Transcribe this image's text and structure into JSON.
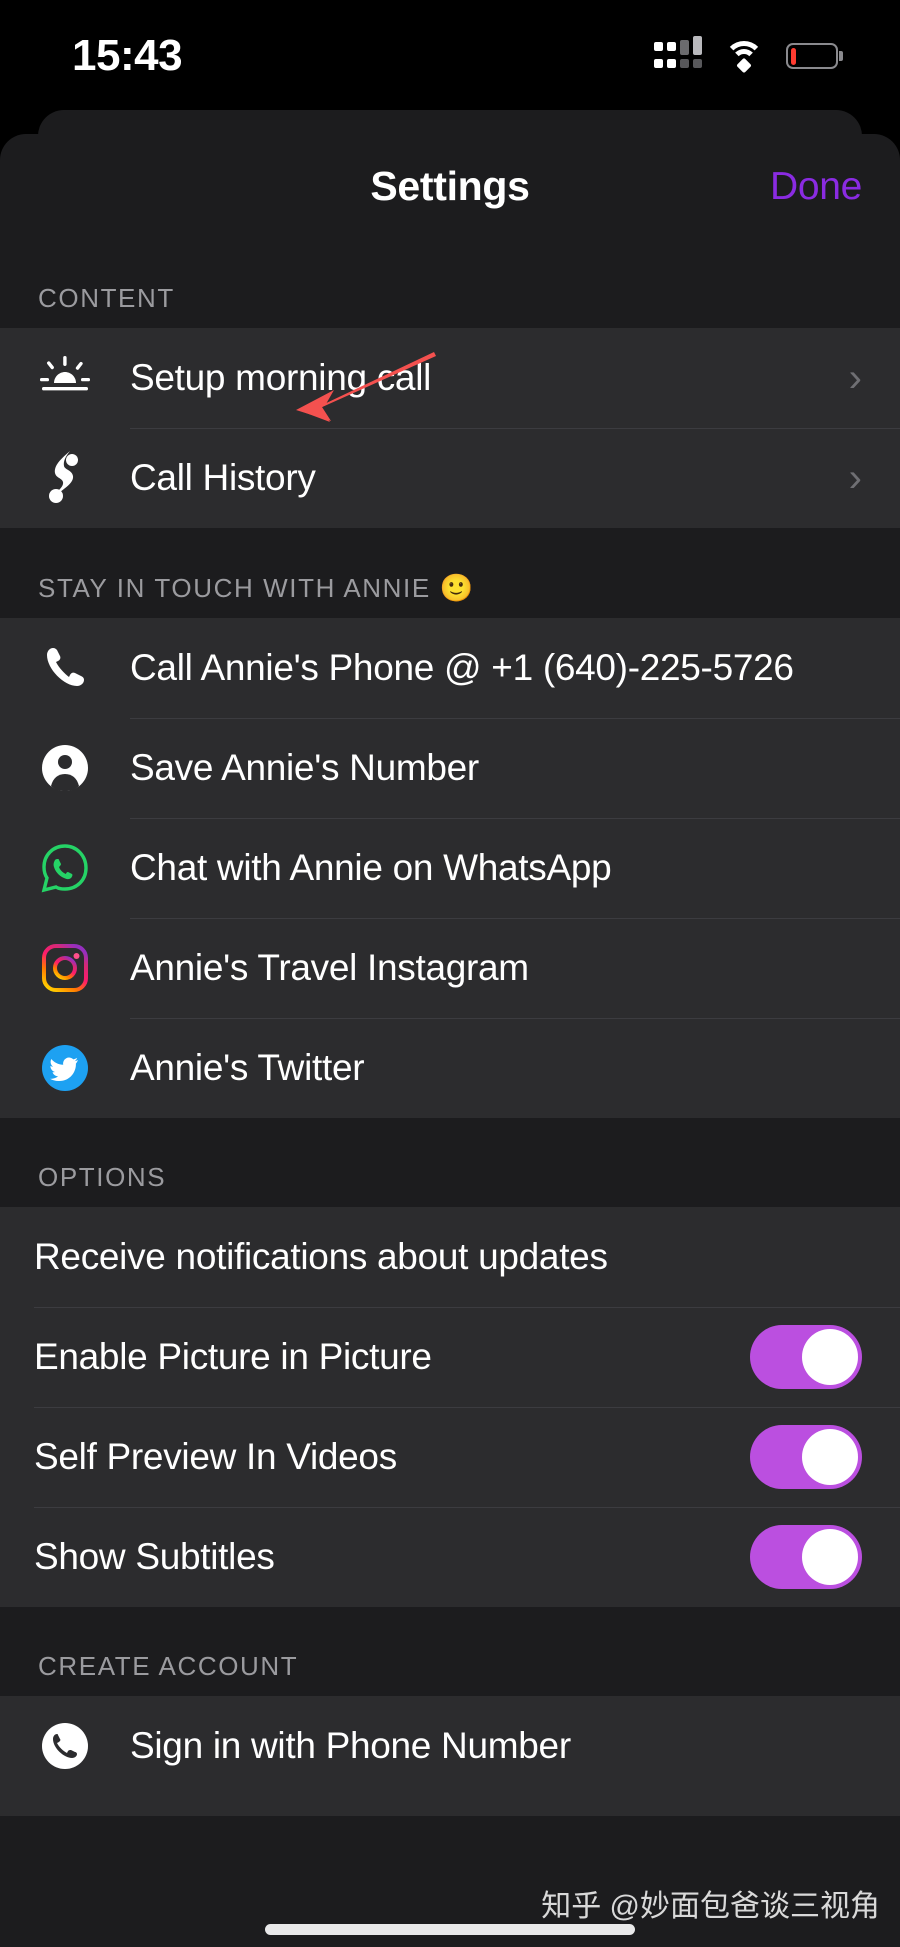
{
  "status_bar": {
    "time": "15:43",
    "signal_icon": "cellular-signal-icon",
    "wifi_icon": "wifi-icon",
    "battery_icon": "battery-low-icon",
    "battery_level_percent": 12,
    "battery_color": "#ff3b30"
  },
  "nav": {
    "title": "Settings",
    "done_label": "Done",
    "done_color": "#8a2be2"
  },
  "sections": [
    {
      "header": "CONTENT",
      "emoji": "",
      "rows": [
        {
          "icon": "sunrise-icon",
          "label": "Setup morning call",
          "accessory": "chevron-right-icon"
        },
        {
          "icon": "call-history-icon",
          "label": "Call History",
          "accessory": "chevron-right-icon"
        }
      ]
    },
    {
      "header": "STAY IN TOUCH WITH ANNIE",
      "emoji": "🙂",
      "rows": [
        {
          "icon": "phone-icon",
          "label": "Call Annie's Phone @ +1 (640)-225-5726",
          "accessory": ""
        },
        {
          "icon": "person-circle-icon",
          "label": "Save Annie's Number",
          "accessory": ""
        },
        {
          "icon": "whatsapp-icon",
          "label": "Chat with Annie on WhatsApp",
          "accessory": ""
        },
        {
          "icon": "instagram-icon",
          "label": "Annie's Travel Instagram",
          "accessory": ""
        },
        {
          "icon": "twitter-icon",
          "label": "Annie's Twitter",
          "accessory": ""
        }
      ]
    },
    {
      "header": "OPTIONS",
      "emoji": "",
      "rows": [
        {
          "icon": "",
          "label": "Receive notifications about updates",
          "accessory": ""
        },
        {
          "icon": "",
          "label": "Enable Picture in Picture",
          "accessory": "toggle",
          "toggle_on": true
        },
        {
          "icon": "",
          "label": "Self Preview In Videos",
          "accessory": "toggle",
          "toggle_on": true
        },
        {
          "icon": "",
          "label": "Show Subtitles",
          "accessory": "toggle",
          "toggle_on": true
        }
      ]
    },
    {
      "header": "CREATE ACCOUNT",
      "emoji": "",
      "rows": [
        {
          "icon": "phone-circle-icon",
          "label": "Sign in with Phone Number",
          "accessory": ""
        }
      ]
    }
  ],
  "annotation": {
    "type": "red-arrow",
    "color": "#f4514f",
    "points_to": "Call History"
  },
  "watermark": "知乎 @妙面包爸谈三视角",
  "toggle_color": "#bb4fe0",
  "chevron_glyph": "›"
}
